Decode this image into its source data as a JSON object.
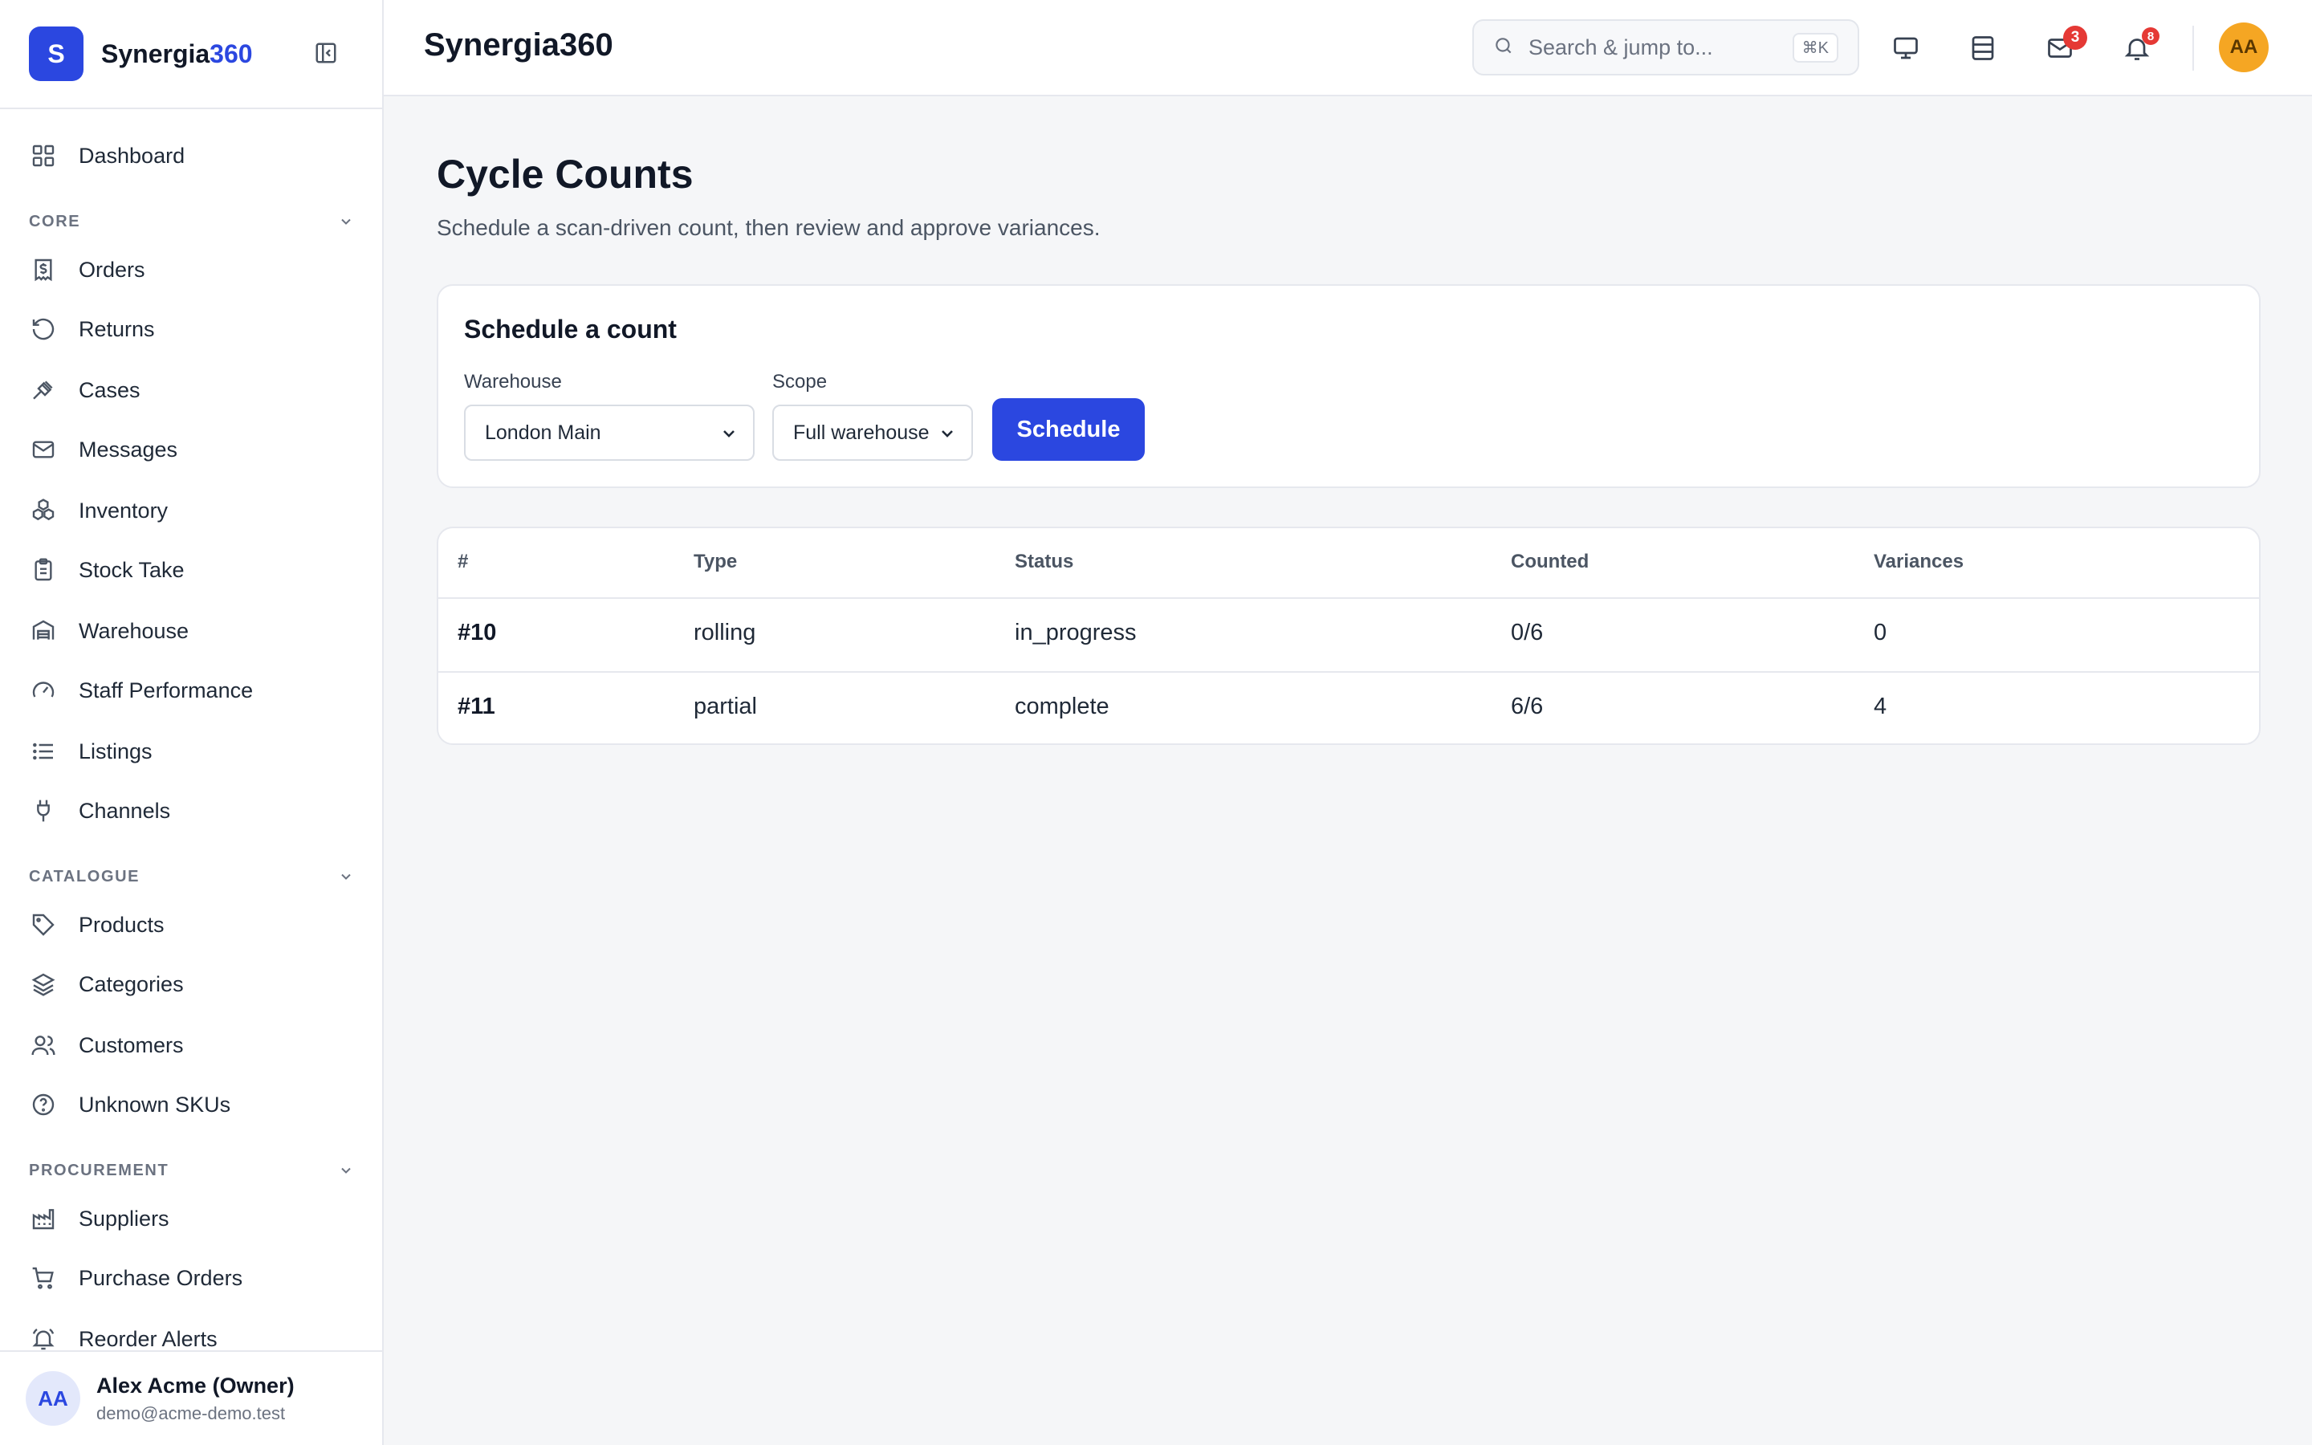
{
  "brand": {
    "logo_letter": "S",
    "name_main": "Synergia",
    "name_accent": "360"
  },
  "sidebar": {
    "top_items": [
      {
        "label": "Dashboard",
        "icon": "grid-icon"
      }
    ],
    "sections": [
      {
        "title": "CORE",
        "items": [
          {
            "label": "Orders",
            "icon": "receipt-dollar-icon"
          },
          {
            "label": "Returns",
            "icon": "rotate-ccw-icon"
          },
          {
            "label": "Cases",
            "icon": "gavel-icon"
          },
          {
            "label": "Messages",
            "icon": "mail-icon"
          },
          {
            "label": "Inventory",
            "icon": "boxes-icon"
          },
          {
            "label": "Stock Take",
            "icon": "clipboard-icon"
          },
          {
            "label": "Warehouse",
            "icon": "warehouse-icon"
          },
          {
            "label": "Staff Performance",
            "icon": "gauge-icon"
          },
          {
            "label": "Listings",
            "icon": "list-icon"
          },
          {
            "label": "Channels",
            "icon": "plug-icon"
          }
        ]
      },
      {
        "title": "CATALOGUE",
        "items": [
          {
            "label": "Products",
            "icon": "tag-icon"
          },
          {
            "label": "Categories",
            "icon": "layers-icon"
          },
          {
            "label": "Customers",
            "icon": "users-icon"
          },
          {
            "label": "Unknown SKUs",
            "icon": "help-circle-icon"
          }
        ]
      },
      {
        "title": "PROCUREMENT",
        "items": [
          {
            "label": "Suppliers",
            "icon": "factory-icon"
          },
          {
            "label": "Purchase Orders",
            "icon": "cart-icon"
          },
          {
            "label": "Reorder Alerts",
            "icon": "bell-ring-icon"
          }
        ]
      }
    ]
  },
  "user": {
    "initials": "AA",
    "name": "Alex Acme (Owner)",
    "email": "demo@acme-demo.test"
  },
  "topbar": {
    "title": "Synergia360",
    "search_placeholder": "Search & jump to...",
    "search_shortcut": "⌘K",
    "mail_badge": "3",
    "bell_badge": "8",
    "avatar_initials": "AA"
  },
  "page": {
    "title": "Cycle Counts",
    "subtitle": "Schedule a scan-driven count, then review and approve variances."
  },
  "schedule_form": {
    "title": "Schedule a count",
    "warehouse_label": "Warehouse",
    "warehouse_value": "London Main",
    "scope_label": "Scope",
    "scope_value": "Full warehouse",
    "button_label": "Schedule"
  },
  "table": {
    "headers": [
      "#",
      "Type",
      "Status",
      "Counted",
      "Variances"
    ],
    "rows": [
      [
        "#10",
        "rolling",
        "in_progress",
        "0/6",
        "0"
      ],
      [
        "#11",
        "partial",
        "complete",
        "6/6",
        "4"
      ]
    ]
  },
  "colors": {
    "primary": "#2b47e0",
    "badge": "#e53935",
    "avatar": "#f5a623"
  }
}
